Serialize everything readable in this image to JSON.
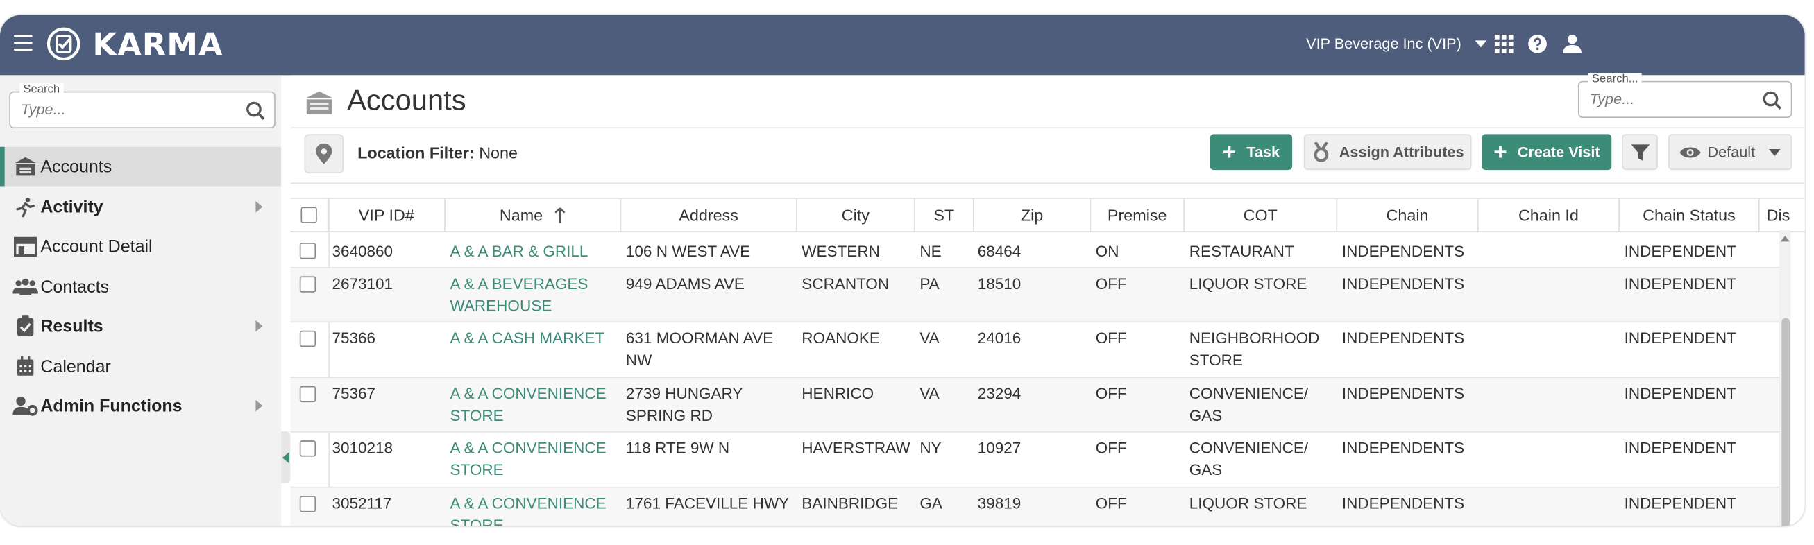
{
  "header": {
    "app_name": "KARMA",
    "company": "VIP Beverage Inc (VIP)"
  },
  "sidebar": {
    "search": {
      "legend": "Search",
      "placeholder": "Type..."
    },
    "items": [
      {
        "label": "Accounts",
        "active": true,
        "expandable": false,
        "icon": "store-icon"
      },
      {
        "label": "Activity",
        "active": false,
        "expandable": true,
        "icon": "running-person-icon"
      },
      {
        "label": "Account Detail",
        "active": false,
        "expandable": false,
        "icon": "storefront-icon"
      },
      {
        "label": "Contacts",
        "active": false,
        "expandable": false,
        "icon": "users-icon"
      },
      {
        "label": "Results",
        "active": false,
        "expandable": true,
        "icon": "clipboard-check-icon"
      },
      {
        "label": "Calendar",
        "active": false,
        "expandable": false,
        "icon": "calendar-icon"
      },
      {
        "label": "Admin Functions",
        "active": false,
        "expandable": true,
        "icon": "user-gear-icon"
      }
    ]
  },
  "page": {
    "title": "Accounts",
    "search": {
      "legend": "Search...",
      "placeholder": "Type..."
    }
  },
  "toolbar": {
    "location_filter_label": "Location Filter:",
    "location_filter_value": "None",
    "task_label": "Task",
    "assign_attributes_label": "Assign Attributes",
    "create_visit_label": "Create Visit",
    "view_label": "Default"
  },
  "table": {
    "columns": [
      "VIP ID#",
      "Name",
      "Address",
      "City",
      "ST",
      "Zip",
      "Premise",
      "COT",
      "Chain",
      "Chain Id",
      "Chain Status",
      "Dis"
    ],
    "sorted_column": "Name",
    "rows": [
      {
        "vip_id": "3640860",
        "name": "A & A BAR & GRILL",
        "address": "106 N WEST AVE",
        "city": "WESTERN",
        "st": "NE",
        "zip": "68464",
        "premise": "ON",
        "cot": "RESTAURANT",
        "chain": "INDEPENDENTS",
        "chain_id": "",
        "chain_status": "INDEPENDENT"
      },
      {
        "vip_id": "2673101",
        "name": "A & A BEVERAGES WAREHOUSE",
        "address": "949 ADAMS AVE",
        "city": "SCRANTON",
        "st": "PA",
        "zip": "18510",
        "premise": "OFF",
        "cot": "LIQUOR STORE",
        "chain": "INDEPENDENTS",
        "chain_id": "",
        "chain_status": "INDEPENDENT"
      },
      {
        "vip_id": "75366",
        "name": "A & A CASH MARKET",
        "address": "631 MOORMAN AVE NW",
        "city": "ROANOKE",
        "st": "VA",
        "zip": "24016",
        "premise": "OFF",
        "cot": "NEIGHBORHOOD STORE",
        "chain": "INDEPENDENTS",
        "chain_id": "",
        "chain_status": "INDEPENDENT"
      },
      {
        "vip_id": "75367",
        "name": "A & A CONVENIENCE STORE",
        "address": "2739 HUNGARY SPRING RD",
        "city": "HENRICO",
        "st": "VA",
        "zip": "23294",
        "premise": "OFF",
        "cot": "CONVENIENCE/ GAS",
        "chain": "INDEPENDENTS",
        "chain_id": "",
        "chain_status": "INDEPENDENT"
      },
      {
        "vip_id": "3010218",
        "name": "A & A CONVENIENCE STORE",
        "address": "118 RTE 9W N",
        "city": "HAVERSTRAW",
        "st": "NY",
        "zip": "10927",
        "premise": "OFF",
        "cot": "CONVENIENCE/ GAS",
        "chain": "INDEPENDENTS",
        "chain_id": "",
        "chain_status": "INDEPENDENT"
      },
      {
        "vip_id": "3052117",
        "name": "A & A CONVENIENCE STORE",
        "address": "1761 FACEVILLE HWY",
        "city": "BAINBRIDGE",
        "st": "GA",
        "zip": "39819",
        "premise": "OFF",
        "cot": "LIQUOR STORE",
        "chain": "INDEPENDENTS",
        "chain_id": "",
        "chain_status": "INDEPENDENT"
      }
    ]
  },
  "colors": {
    "header_bg": "#4e5d7b",
    "accent": "#3d8c77",
    "sidebar_bg": "#f2f2f2"
  }
}
